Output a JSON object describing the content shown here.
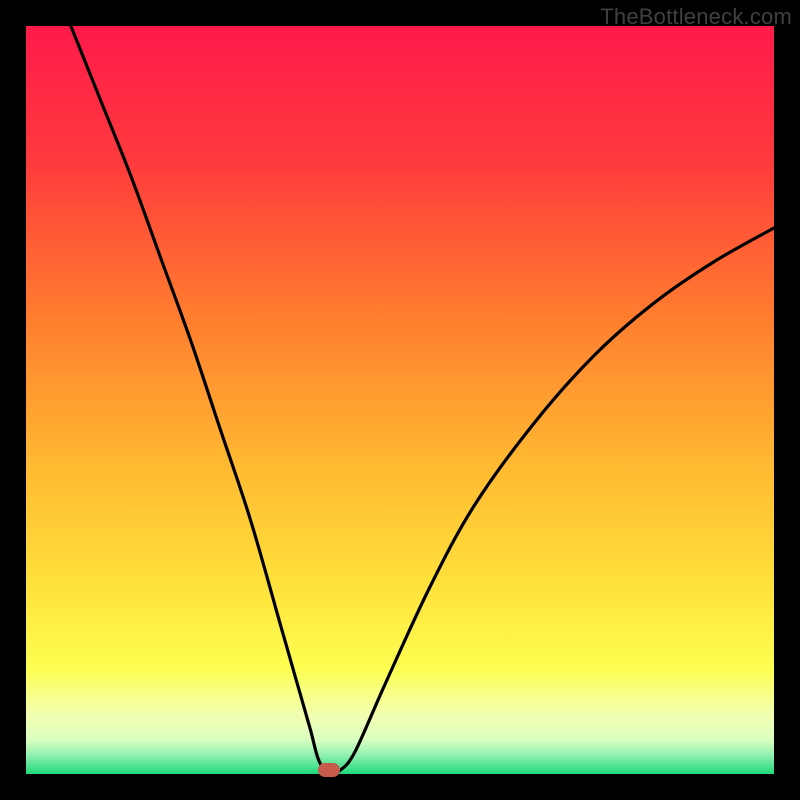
{
  "watermark": "TheBottleneck.com",
  "colors": {
    "gradient_stops": [
      {
        "offset": 0.0,
        "color": "#ff1a4b"
      },
      {
        "offset": 0.18,
        "color": "#ff3a3d"
      },
      {
        "offset": 0.38,
        "color": "#ff7a2f"
      },
      {
        "offset": 0.58,
        "color": "#ffb731"
      },
      {
        "offset": 0.75,
        "color": "#ffe23b"
      },
      {
        "offset": 0.86,
        "color": "#fdff51"
      },
      {
        "offset": 0.92,
        "color": "#f2ffb0"
      },
      {
        "offset": 0.955,
        "color": "#d8ffc0"
      },
      {
        "offset": 0.975,
        "color": "#8ff0b0"
      },
      {
        "offset": 1.0,
        "color": "#1fd97a"
      }
    ],
    "curve": "#000000",
    "marker": "#c75a4b",
    "frame_bg": "#000000"
  },
  "chart_data": {
    "type": "line",
    "title": "",
    "xlabel": "",
    "ylabel": "",
    "x_range": [
      0,
      100
    ],
    "y_range": [
      0,
      100
    ],
    "series": [
      {
        "name": "bottleneck-curve",
        "x": [
          6,
          10,
          14,
          18,
          22,
          26,
          30,
          34,
          36,
          38,
          39,
          40,
          41,
          42,
          44,
          48,
          54,
          60,
          68,
          76,
          84,
          92,
          100
        ],
        "y": [
          100,
          90,
          80,
          69,
          58,
          46,
          34,
          20,
          13,
          6,
          2.2,
          0.5,
          0.5,
          0.5,
          3,
          12,
          25,
          36,
          47,
          56,
          63,
          68.5,
          73
        ]
      }
    ],
    "marker": {
      "x": 40.5,
      "y": 0.5
    },
    "annotations": []
  }
}
